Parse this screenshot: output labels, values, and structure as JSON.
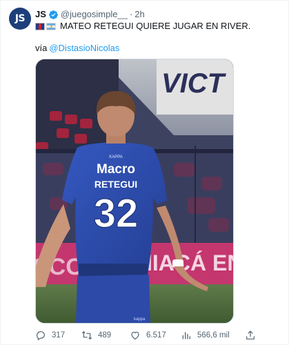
{
  "author": {
    "avatar_text": "JS",
    "display_name": "JS",
    "handle": "@juegosimple__",
    "separator": "·",
    "time": "2h",
    "verified": true
  },
  "tweet": {
    "headline": "MATEO RETEGUI QUIERE JUGAR EN RIVER.",
    "via_prefix": "vía",
    "via_mention": "@DistasioNicolas"
  },
  "media": {
    "jersey_sponsor": "Macro",
    "jersey_name": "RETEGUI",
    "jersey_number": "32",
    "jersey_brand_top": "KAPPA",
    "shorts_brand": "kappa",
    "stadium_top_text": "VICT",
    "board_text_left": "SCOTIA",
    "board_text_right": "IIACÁ EN"
  },
  "actions": {
    "replies": "317",
    "retweets": "489",
    "likes": "6.517",
    "views": "566,6 mil"
  },
  "colors": {
    "avatar_bg": "#1d3f7a",
    "link": "#1d9bf0",
    "muted": "#536471",
    "verified": "#1d9bf0",
    "jersey": "#2d4fb3"
  }
}
